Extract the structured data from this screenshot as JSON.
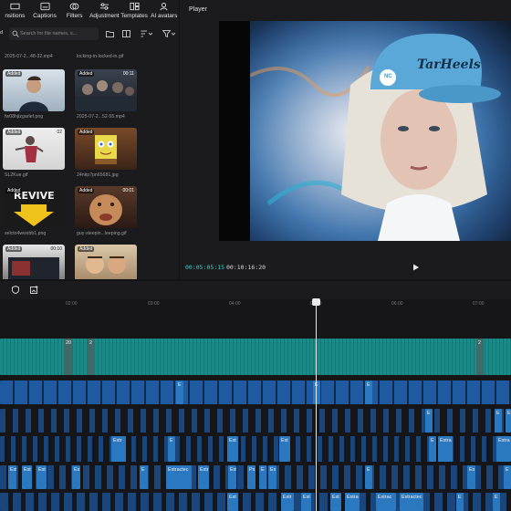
{
  "toolbar": {
    "items": [
      {
        "label": "nsitions",
        "icon": "transitions-icon"
      },
      {
        "label": "Captions",
        "icon": "captions-icon"
      },
      {
        "label": "Filters",
        "icon": "filters-icon"
      },
      {
        "label": "Adjustment",
        "icon": "adjustment-icon"
      },
      {
        "label": "Templates",
        "icon": "templates-icon"
      },
      {
        "label": "AI avatars",
        "icon": "ai-avatars-icon"
      }
    ]
  },
  "media": {
    "search_placeholder": "Search for file names, s...",
    "tab_fragment": "d",
    "top_files": [
      "2025-07-2...48-32.mp4",
      "locking-in-locked-in.gif"
    ],
    "badge_added": "Added",
    "items": [
      {
        "name": "fw08hjtzgarlef.png",
        "duration": ""
      },
      {
        "name": "2025-07-2...52-55.mp4",
        "duration": "00:11"
      },
      {
        "name": "SL2Kue.gif",
        "duration": "02"
      },
      {
        "name": "24nkp7pn65681.jpg",
        "duration": ""
      },
      {
        "name": "selcto4wwsbb1.png",
        "duration": ""
      },
      {
        "name": "guy-sleepin...leeping.gif",
        "duration": "00:01"
      },
      {
        "name": "",
        "duration": "00:10"
      },
      {
        "name": "",
        "duration": ""
      }
    ],
    "thumb_text_revive": "REVIVE"
  },
  "player": {
    "title": "Player",
    "current_time": "00:05:05:15",
    "total_time": "00:10:16:20",
    "hat_text": "TarHeels",
    "hat_logo": "NC"
  },
  "timeline": {
    "ruler_ticks": [
      "02:00",
      "03:00",
      "04:00",
      "05:00",
      "06:00",
      "07:00"
    ],
    "main_markers": [
      "20",
      "2",
      "2"
    ],
    "clip_labels": {
      "e": "E",
      "extr": "Extr",
      "ext": "Ext",
      "extra": "Extra",
      "extractec": "Extractec",
      "ex": "Ex",
      "ps": "Ps",
      "extrac": "Extrac",
      "extractec2": "Extractec"
    }
  },
  "colors": {
    "teal_track": "#1c8a86",
    "blue_track": "#1f5aa0",
    "accent_timecode": "#2fd1c6"
  }
}
